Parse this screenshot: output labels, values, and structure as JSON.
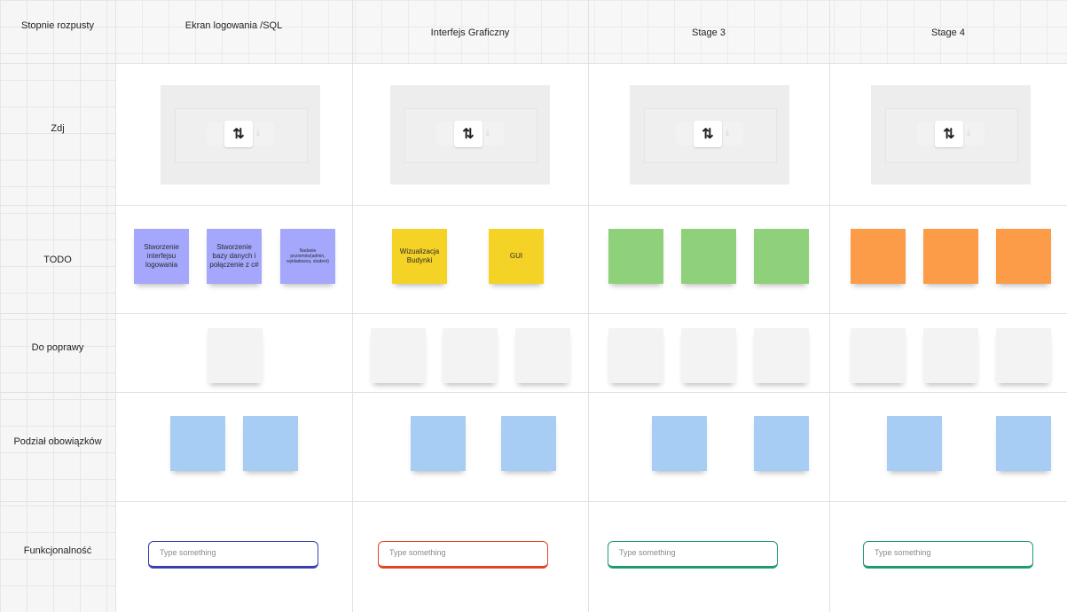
{
  "row_labels": {
    "stages": "Stopnie rozpusty",
    "photo": "Zdj",
    "todo": "TODO",
    "fixes": "Do poprawy",
    "duties": "Podział obowiązków",
    "features": "Funkcjonalność"
  },
  "columns": [
    {
      "title": "Ekran logowania /SQL",
      "input_placeholder": "Type something",
      "input_color": "#3a3fb0"
    },
    {
      "title": "Interfejs Graficzny",
      "input_placeholder": "Type something",
      "input_color": "#e0452a"
    },
    {
      "title": "Stage 3",
      "input_placeholder": "Type something",
      "input_color": "#1f9a74"
    },
    {
      "title": "Stage 4",
      "input_placeholder": "Type something",
      "input_color": "#1f9a74"
    }
  ],
  "todo_notes": {
    "col1": [
      {
        "text": "Stworzenie interfejsu logowania",
        "color": "#a4a7fb"
      },
      {
        "text": "Stworzenie bazy danych i połączenie z c#",
        "color": "#a4a7fb"
      },
      {
        "text": "Nadanie poziomów(admin, wykładowca, student)",
        "color": "#a4a7fb"
      }
    ],
    "col2": [
      {
        "text": "Wizualizacja Budynki",
        "color": "#f5d226"
      },
      {
        "text": "GUI",
        "color": "#f5d226"
      }
    ]
  },
  "colors": {
    "purple": "#a4a7fb",
    "yellow": "#f5d226",
    "green": "#8ed17a",
    "orange": "#fd9c48",
    "white": "#f3f3f3",
    "blue": "#a8cdf5"
  },
  "icons": {
    "image_swap": "swap-arrows-icon",
    "image_download": "download-icon"
  },
  "swap_glyph": "⇅"
}
